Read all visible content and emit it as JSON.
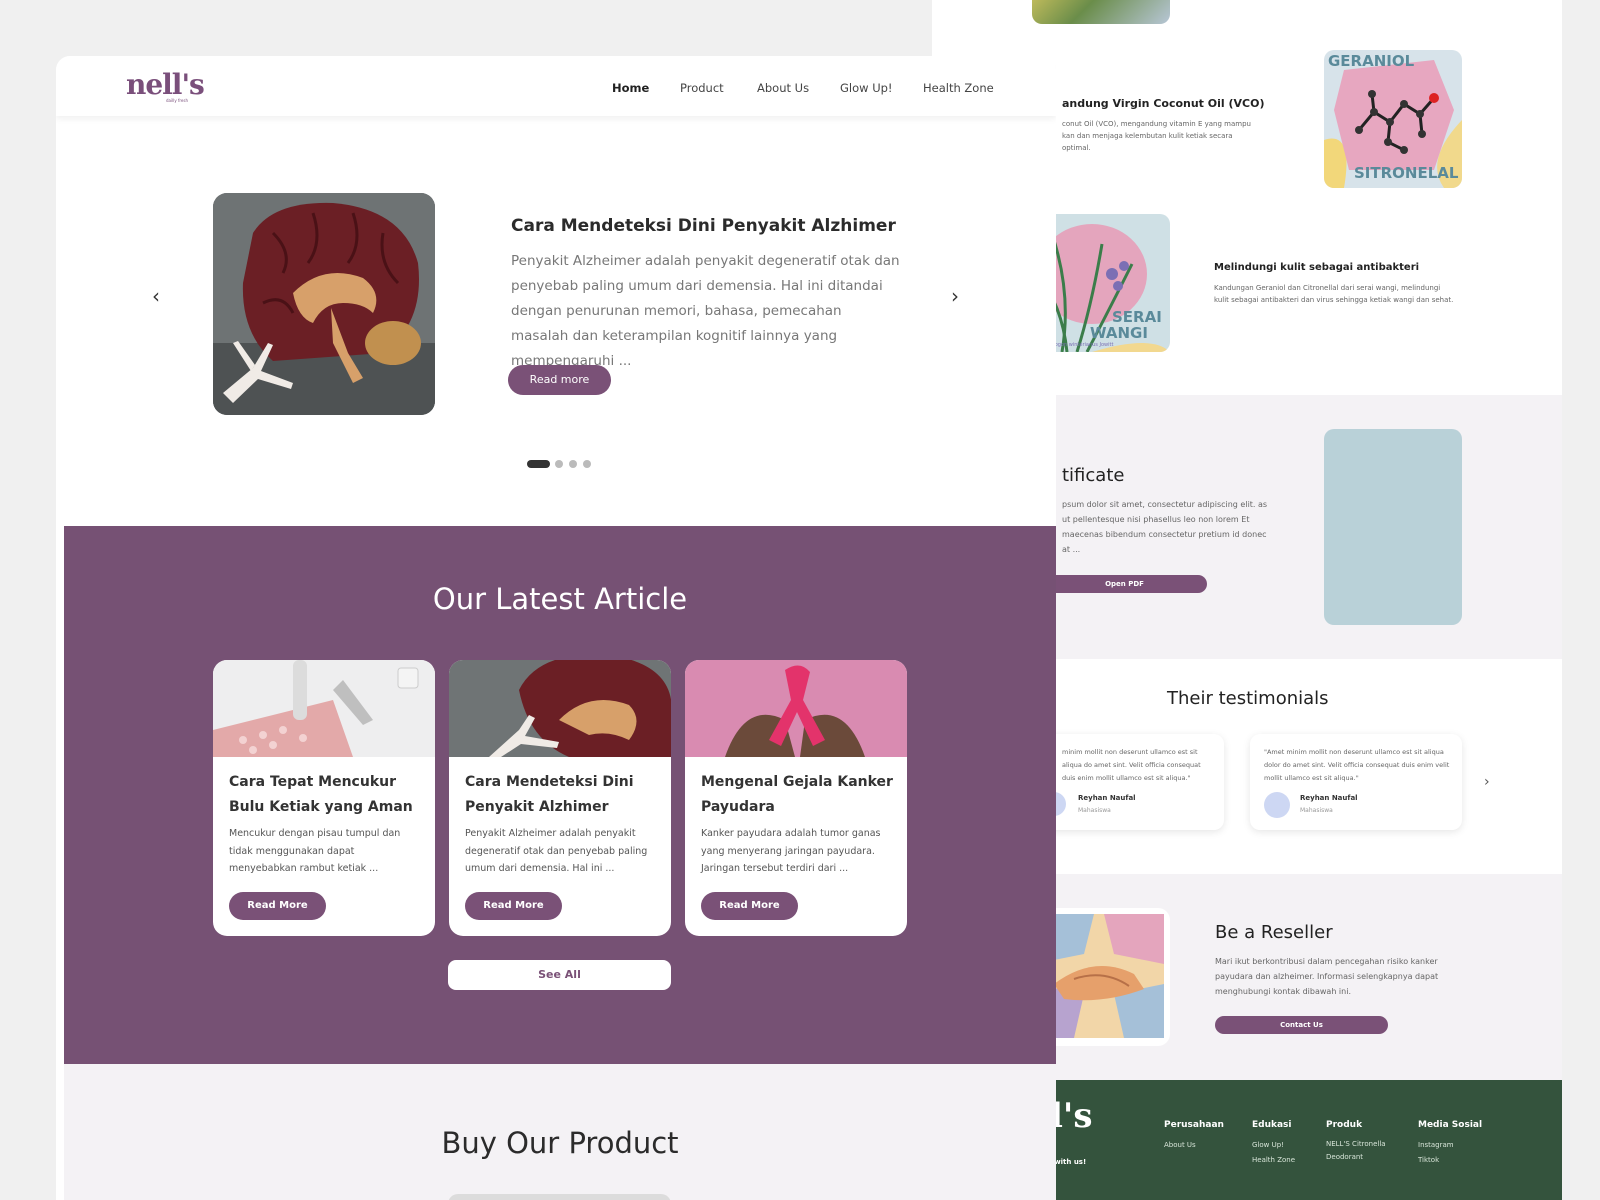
{
  "colors": {
    "purple": "#765174",
    "accent": "#7a5177",
    "green": "#34533d",
    "light": "#f4f2f5"
  },
  "back": {
    "feature1": {
      "title": "andung Virgin Coconut Oil (VCO)",
      "text": "conut Oil (VCO), mengandung vitamin E yang mampu kan dan menjaga kelembutan kulit ketiak secara optimal."
    },
    "geraniol": {
      "top_label": "GERANIOL",
      "bottom_label": "SITRONELAL"
    },
    "serai": {
      "label1": "SERAI",
      "label2": "WANGI",
      "caption": "Cymbopogon winterianus Jowitt"
    },
    "feature2": {
      "title": "Melindungi kulit sebagai antibakteri",
      "text": "Kandungan Geraniol dan Citronellal dari serai wangi, melindungi kulit sebagai antibakteri dan virus sehingga ketiak wangi dan sehat."
    },
    "certificate": {
      "title": "tificate",
      "text": "psum dolor sit amet, consectetur adipiscing elit. as ut pellentesque nisi phasellus leo non lorem Et maecenas bibendum consectetur pretium id donec at ...",
      "button": "Open PDF"
    },
    "testimonials": {
      "title": "Their testimonials",
      "items": [
        {
          "quote": "minim mollit non deserunt ullamco est sit aliqua do amet sint. Velit officia consequat duis enim mollit ullamco est sit aliqua.\"",
          "name": "Reyhan Naufal",
          "role": "Mahasiswa"
        },
        {
          "quote": "\"Amet minim mollit non deserunt ullamco est sit aliqua dolor do amet sint. Velit officia consequat duis enim velit mollit ullamco est sit aliqua.\"",
          "name": "Reyhan Naufal",
          "role": "Mahasiswa"
        }
      ]
    },
    "reseller": {
      "title": "Be a Reseller",
      "text": "Mari ikut berkontribusi dalam pencegahan risiko kanker payudara dan alzheimer. Informasi selengkapnya dapat menghubungi kontak dibawah ini.",
      "button": "Contact Us"
    },
    "footer": {
      "logo": "l's",
      "tagline": "ed with us!",
      "cols": [
        {
          "head": "Perusahaan",
          "links": [
            "About Us"
          ]
        },
        {
          "head": "Edukasi",
          "links": [
            "Glow Up!",
            "Health Zone"
          ]
        },
        {
          "head": "Produk",
          "links": [
            "NELL'S Citronella",
            "Deodorant"
          ]
        },
        {
          "head": "Media Sosial",
          "links": [
            "Instagram",
            "Tiktok"
          ]
        }
      ]
    }
  },
  "nav": {
    "logo": "nell's",
    "logo_sub": "dailly fresh",
    "links": [
      "Home",
      "Product",
      "About Us",
      "Glow Up!",
      "Health Zone"
    ]
  },
  "hero": {
    "title": "Cara Mendeteksi Dini Penyakit Alzhimer",
    "text": "Penyakit Alzheimer adalah penyakit degeneratif otak dan penyebab paling umum dari demensia. Hal ini ditandai dengan penurunan memori, bahasa, pemecahan masalah dan keterampilan kognitif lainnya yang mempengaruhi ...",
    "button": "Read more",
    "slide_index": 1,
    "slide_count": 4
  },
  "latest": {
    "title": "Our Latest Article",
    "cards": [
      {
        "title": "Cara Tepat Mencukur Bulu Ketiak yang Aman",
        "text": "Mencukur dengan pisau tumpul dan tidak menggunakan dapat menyebabkan rambut ketiak ...",
        "button": "Read More"
      },
      {
        "title": "Cara Mendeteksi Dini Penyakit Alzhimer",
        "text": "Penyakit Alzheimer adalah penyakit degeneratif otak dan penyebab paling umum dari demensia. Hal ini ...",
        "button": "Read More"
      },
      {
        "title": "Mengenal Gejala Kanker Payudara",
        "text": "Kanker payudara adalah tumor ganas yang menyerang jaringan payudara. Jaringan tersebut terdiri dari ...",
        "button": "Read More"
      }
    ],
    "see_all": "See All"
  },
  "product": {
    "title": "Buy Our Product"
  }
}
